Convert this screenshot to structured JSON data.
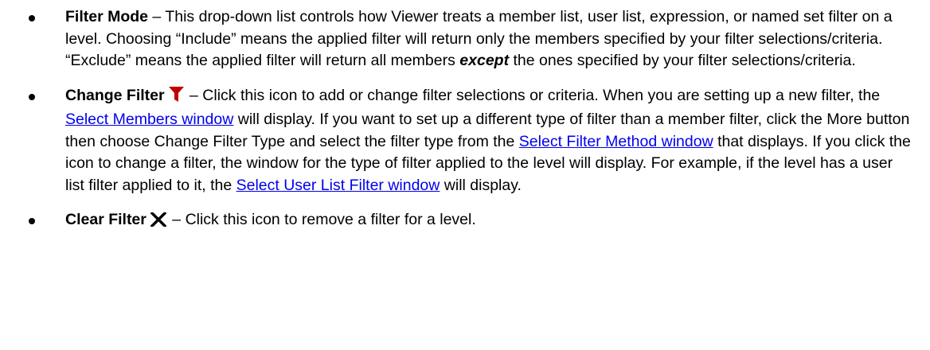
{
  "items": [
    {
      "term": "Filter Mode",
      "dash": " – ",
      "text1": "This drop-down list controls how Viewer treats a member list, user list, expression, or named set filter on a level. Choosing “Include” means the applied filter will return only the members specified by your filter selections/criteria. “Exclude” means the applied filter will return all members ",
      "emph": "except",
      "text2": " the ones specified by your filter selections/criteria."
    },
    {
      "term": "Change Filter",
      "icon": "red-funnel-filter-icon",
      "icon_color": "#C00000",
      "dash": " – ",
      "text1": "Click this icon to add or change filter selections or criteria. When you are setting up a new filter, the ",
      "link1": "Select Members window",
      "text2": " will display. If you want to set up a different type of filter than a member filter, click the More button then choose Change Filter Type and select the filter type from the ",
      "link2": "Select Filter Method window",
      "text3": " that displays. If you click the icon to change a filter, the window for the type of filter applied to the level will display. For example, if the level has a user list filter applied to it, the ",
      "link3": "Select User List Filter window",
      "text4": " will display."
    },
    {
      "term": "Clear Filter",
      "icon": "x-close-icon",
      "dash": " – ",
      "text1": "Click this icon to remove a filter for a level."
    }
  ],
  "colors": {
    "link": "#0000EE",
    "text": "#000000"
  }
}
